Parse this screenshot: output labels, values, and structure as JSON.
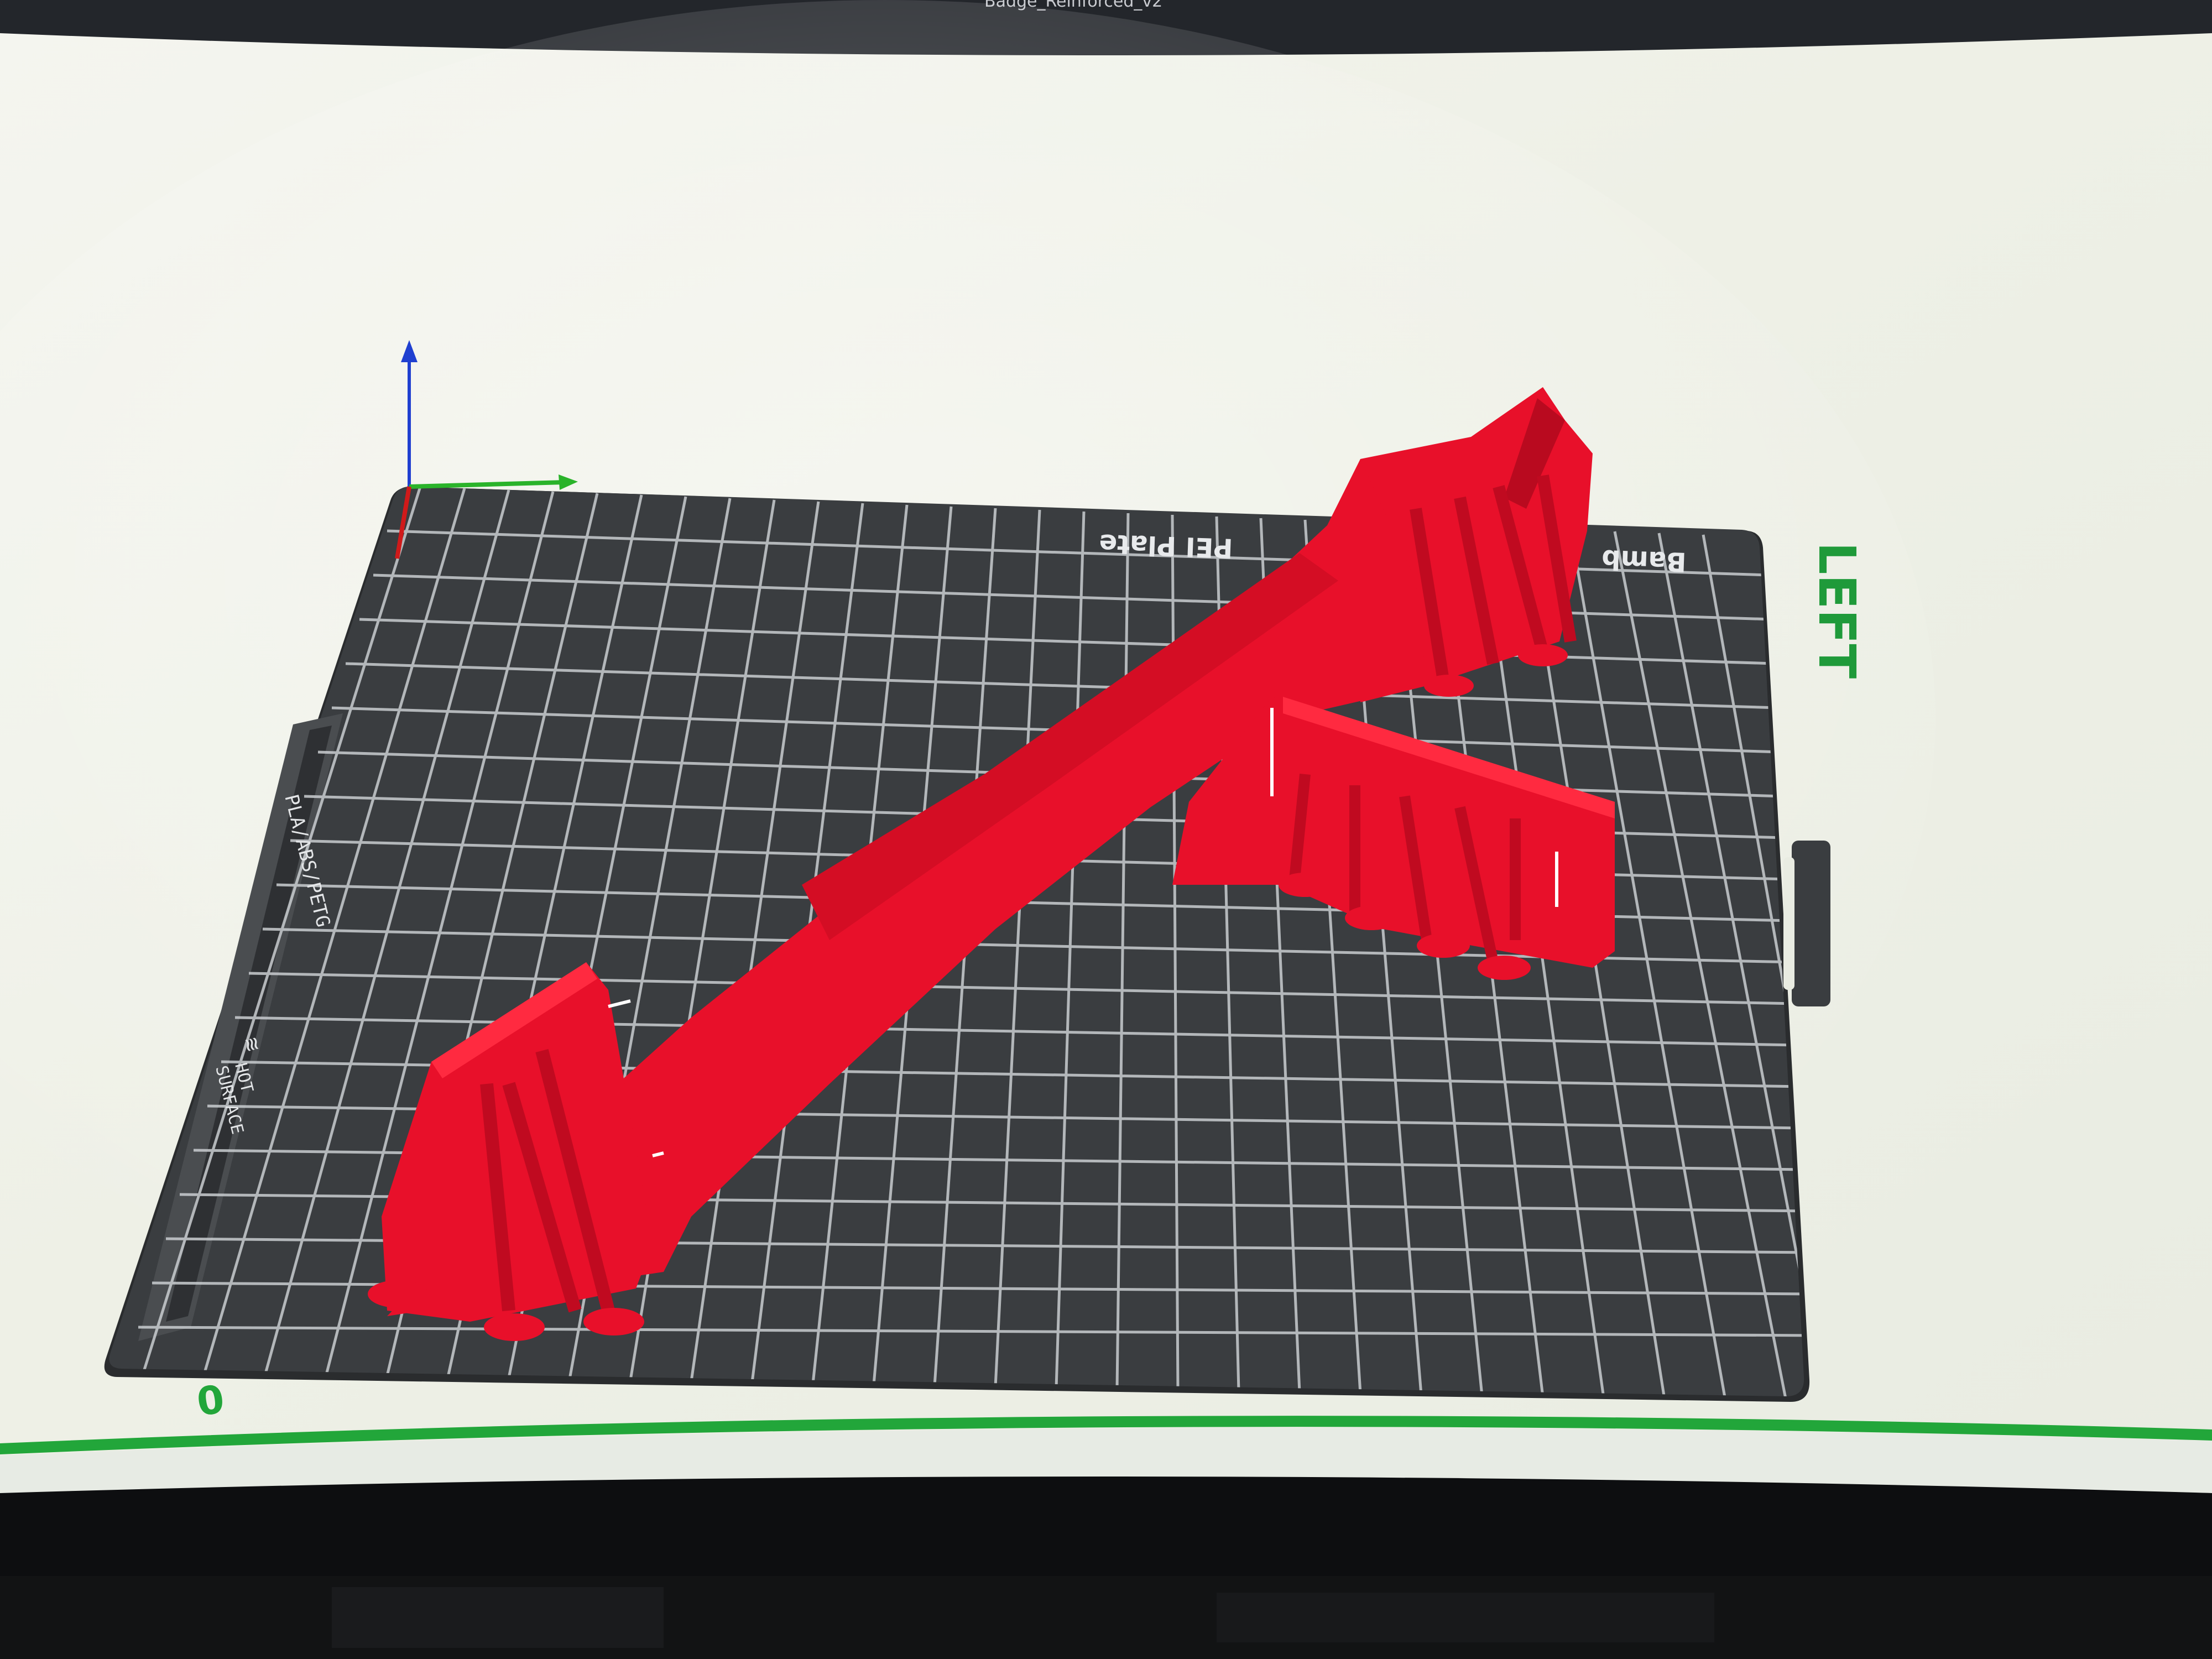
{
  "window": {
    "title": "Badge_Reinforced_v2"
  },
  "viewport": {
    "view_label": "LEFT",
    "corner_label": "0"
  },
  "build_plate": {
    "name_visible_left": "Bamb",
    "name_visible_right": "PEI Plate",
    "material_label": "PLA/ABS/PETG",
    "surface_label_1": "HOT",
    "surface_label_2": "SURFACE"
  },
  "colors": {
    "model": "#e8102a",
    "plate": "#3a3d40",
    "grid": "#c9cdd0",
    "viewport_bg": "#f1f2ea",
    "view_label": "#1f9a3a",
    "axis_z": "#1f3fd0",
    "axis_y": "#2ab32a",
    "axis_x": "#d01a1a"
  },
  "icons": [
    "axis-gizmo-icon",
    "hot-surface-icon"
  ]
}
